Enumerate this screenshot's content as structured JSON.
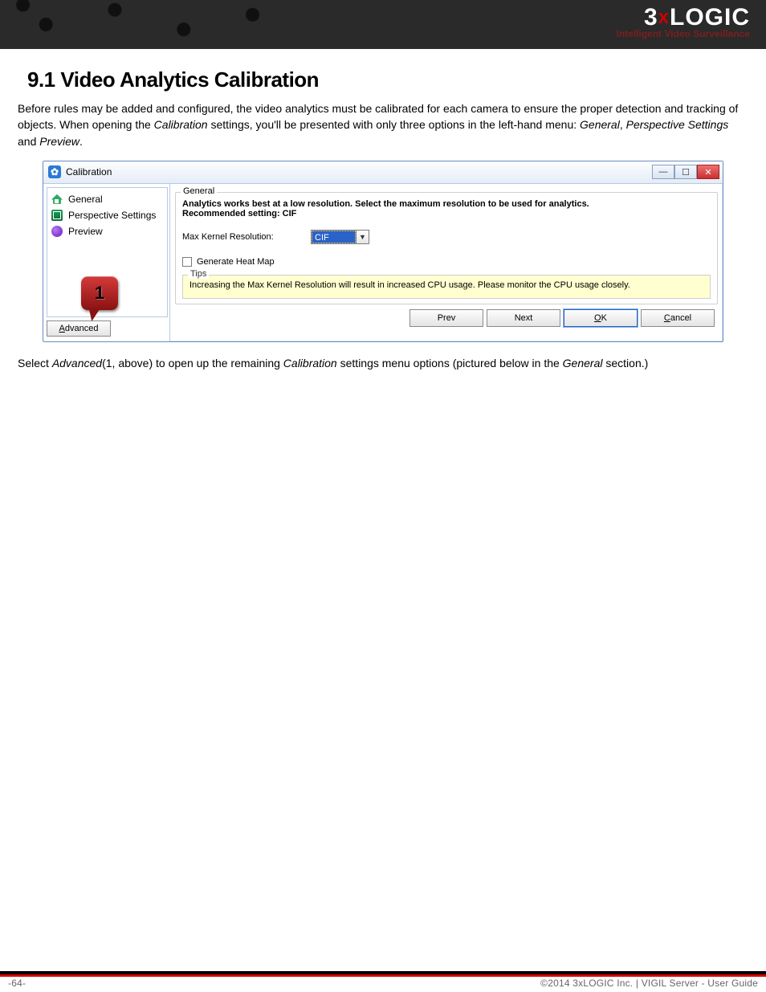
{
  "header": {
    "brand_prefix": "3",
    "brand_x": "x",
    "brand_suffix": "LOGIC",
    "tagline": "Intelligent Video Surveillance"
  },
  "doc": {
    "heading": "9.1 Video Analytics Calibration",
    "intro_1": "Before rules may be added and configured, the video analytics must be calibrated for each camera to ensure the proper detection and tracking of objects. When opening the ",
    "intro_em1": "Calibration",
    "intro_2": " settings, you'll be presented with only three options in the left-hand menu: ",
    "intro_em2": "General",
    "intro_3": ", ",
    "intro_em3": "Perspective Settings",
    "intro_4": " and ",
    "intro_em4": "Preview",
    "intro_5": ".",
    "after_1": "Select ",
    "after_em1": "Advanced",
    "after_2": "(1, above) to open up the remaining ",
    "after_em2": "Calibration",
    "after_3": " settings menu options (pictured below in the ",
    "after_em3": "General",
    "after_4": " section.)"
  },
  "dialog": {
    "title": "Calibration",
    "title_icon_glyph": "✿",
    "tree": {
      "general": "General",
      "perspective": "Perspective Settings",
      "preview": "Preview"
    },
    "callout_number": "1",
    "advanced_label": "Advanced",
    "group": {
      "title": "General",
      "line1": "Analytics works best at a low resolution.  Select the maximum resolution to be used for analytics.",
      "line2": "Recommended setting: CIF",
      "max_kernel_label": "Max Kernel Resolution:",
      "combo_value": "CIF",
      "heatmap_label": "Generate Heat Map"
    },
    "tips": {
      "title": "Tips",
      "text": "Increasing the Max Kernel Resolution will result in increased CPU usage.  Please monitor the CPU usage closely."
    },
    "buttons": {
      "prev": "Prev",
      "next": "Next",
      "ok": "OK",
      "cancel": "Cancel"
    },
    "window_buttons": {
      "min": "—",
      "max": "☐",
      "close": "✕"
    }
  },
  "footer": {
    "page": "-64-",
    "copyright": "©2014 3xLOGIC Inc. | VIGIL Server - User Guide"
  }
}
